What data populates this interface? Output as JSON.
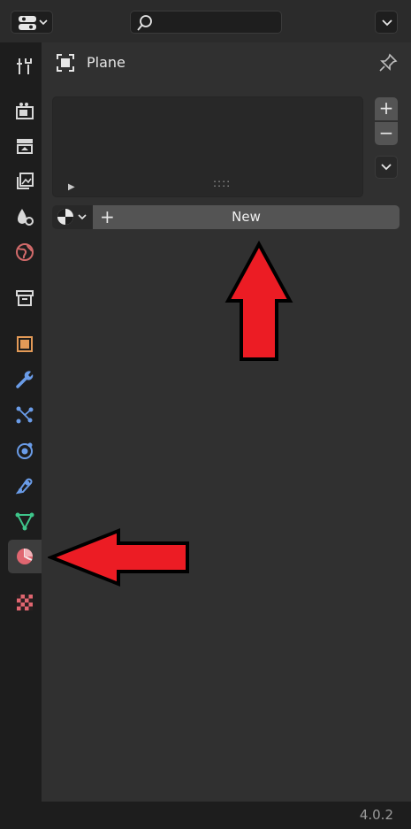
{
  "header": {
    "editor_type_icon": "properties-editor-icon",
    "search_icon": "search-icon",
    "dropdown_icon": "chevron-down-icon"
  },
  "tabs": [
    {
      "name": "tool",
      "icon": "tool-wrench-screwdriver-icon",
      "active": false
    },
    {
      "name": "render",
      "icon": "render-camera-icon",
      "active": false
    },
    {
      "name": "output",
      "icon": "output-printer-icon",
      "active": false
    },
    {
      "name": "view-layer",
      "icon": "view-layer-icon",
      "active": false
    },
    {
      "name": "scene",
      "icon": "scene-icon",
      "active": false
    },
    {
      "name": "world",
      "icon": "world-icon",
      "active": false
    },
    {
      "name": "collection",
      "icon": "collection-box-icon",
      "active": false
    },
    {
      "name": "object",
      "icon": "object-square-icon",
      "active": false
    },
    {
      "name": "modifiers",
      "icon": "wrench-icon",
      "active": false
    },
    {
      "name": "particles",
      "icon": "particles-icon",
      "active": false
    },
    {
      "name": "physics",
      "icon": "physics-orbit-icon",
      "active": false
    },
    {
      "name": "constraints",
      "icon": "constraints-icon",
      "active": false
    },
    {
      "name": "data",
      "icon": "mesh-data-triangle-icon",
      "active": false
    },
    {
      "name": "material",
      "icon": "material-sphere-icon",
      "active": true
    },
    {
      "name": "texture",
      "icon": "texture-checker-icon",
      "active": false
    }
  ],
  "panel": {
    "context_icon": "object-square-icon",
    "object_name": "Plane",
    "pin_icon": "pin-icon",
    "slot_add": "+",
    "slot_remove": "−",
    "slot_play_icon": "▶",
    "slot_grip": "::::",
    "browse_icon": "material-browse-icon",
    "new_plus": "+",
    "new_label": "New"
  },
  "annotations": {
    "arrow_up_color": "#ec1c24",
    "arrow_left_color": "#ec1c24"
  },
  "status": {
    "version": "4.0.2"
  },
  "colors": {
    "background": "#1d1d1d",
    "panel": "#303030",
    "button": "#545454",
    "material_accent": "#e06670"
  }
}
